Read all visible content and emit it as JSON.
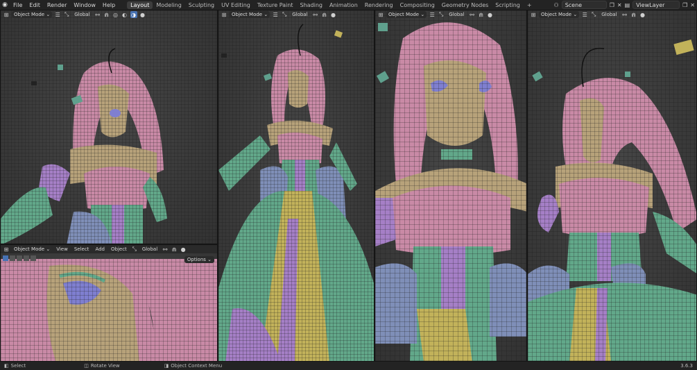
{
  "menu": [
    "File",
    "Edit",
    "Render",
    "Window",
    "Help"
  ],
  "workspaces": [
    "Layout",
    "Modeling",
    "Sculpting",
    "UV Editing",
    "Texture Paint",
    "Shading",
    "Animation",
    "Rendering",
    "Compositing",
    "Geometry Nodes",
    "Scripting",
    "+"
  ],
  "active_workspace": "Layout",
  "scene": {
    "label": "Scene",
    "view_layer": "ViewLayer"
  },
  "viewport": {
    "mode": "Object Mode",
    "orientation": "Global"
  },
  "bottom_left_viewport": {
    "menus": [
      "View",
      "Select",
      "Add",
      "Object"
    ],
    "options": "Options"
  },
  "status_bar": {
    "select": "Select",
    "rotate": "Rotate View",
    "context": "Object Context Menu",
    "version": "3.6.3"
  },
  "colors": {
    "wire_pink": "#c98aa6",
    "wire_green": "#62a88a",
    "wire_purple": "#a57fc6",
    "wire_blue": "#7f8fb8",
    "skin": "#b7a27a",
    "accent": "#4772b3"
  }
}
